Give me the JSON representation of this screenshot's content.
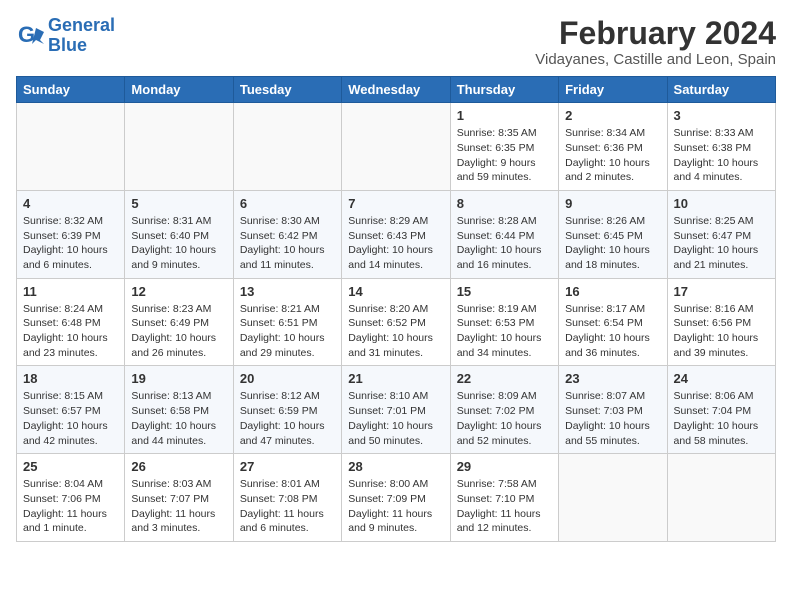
{
  "logo": {
    "text_general": "General",
    "text_blue": "Blue"
  },
  "title": "February 2024",
  "subtitle": "Vidayanes, Castille and Leon, Spain",
  "weekdays": [
    "Sunday",
    "Monday",
    "Tuesday",
    "Wednesday",
    "Thursday",
    "Friday",
    "Saturday"
  ],
  "weeks": [
    [
      {
        "day": "",
        "info": ""
      },
      {
        "day": "",
        "info": ""
      },
      {
        "day": "",
        "info": ""
      },
      {
        "day": "",
        "info": ""
      },
      {
        "day": "1",
        "info": "Sunrise: 8:35 AM\nSunset: 6:35 PM\nDaylight: 9 hours\nand 59 minutes."
      },
      {
        "day": "2",
        "info": "Sunrise: 8:34 AM\nSunset: 6:36 PM\nDaylight: 10 hours\nand 2 minutes."
      },
      {
        "day": "3",
        "info": "Sunrise: 8:33 AM\nSunset: 6:38 PM\nDaylight: 10 hours\nand 4 minutes."
      }
    ],
    [
      {
        "day": "4",
        "info": "Sunrise: 8:32 AM\nSunset: 6:39 PM\nDaylight: 10 hours\nand 6 minutes."
      },
      {
        "day": "5",
        "info": "Sunrise: 8:31 AM\nSunset: 6:40 PM\nDaylight: 10 hours\nand 9 minutes."
      },
      {
        "day": "6",
        "info": "Sunrise: 8:30 AM\nSunset: 6:42 PM\nDaylight: 10 hours\nand 11 minutes."
      },
      {
        "day": "7",
        "info": "Sunrise: 8:29 AM\nSunset: 6:43 PM\nDaylight: 10 hours\nand 14 minutes."
      },
      {
        "day": "8",
        "info": "Sunrise: 8:28 AM\nSunset: 6:44 PM\nDaylight: 10 hours\nand 16 minutes."
      },
      {
        "day": "9",
        "info": "Sunrise: 8:26 AM\nSunset: 6:45 PM\nDaylight: 10 hours\nand 18 minutes."
      },
      {
        "day": "10",
        "info": "Sunrise: 8:25 AM\nSunset: 6:47 PM\nDaylight: 10 hours\nand 21 minutes."
      }
    ],
    [
      {
        "day": "11",
        "info": "Sunrise: 8:24 AM\nSunset: 6:48 PM\nDaylight: 10 hours\nand 23 minutes."
      },
      {
        "day": "12",
        "info": "Sunrise: 8:23 AM\nSunset: 6:49 PM\nDaylight: 10 hours\nand 26 minutes."
      },
      {
        "day": "13",
        "info": "Sunrise: 8:21 AM\nSunset: 6:51 PM\nDaylight: 10 hours\nand 29 minutes."
      },
      {
        "day": "14",
        "info": "Sunrise: 8:20 AM\nSunset: 6:52 PM\nDaylight: 10 hours\nand 31 minutes."
      },
      {
        "day": "15",
        "info": "Sunrise: 8:19 AM\nSunset: 6:53 PM\nDaylight: 10 hours\nand 34 minutes."
      },
      {
        "day": "16",
        "info": "Sunrise: 8:17 AM\nSunset: 6:54 PM\nDaylight: 10 hours\nand 36 minutes."
      },
      {
        "day": "17",
        "info": "Sunrise: 8:16 AM\nSunset: 6:56 PM\nDaylight: 10 hours\nand 39 minutes."
      }
    ],
    [
      {
        "day": "18",
        "info": "Sunrise: 8:15 AM\nSunset: 6:57 PM\nDaylight: 10 hours\nand 42 minutes."
      },
      {
        "day": "19",
        "info": "Sunrise: 8:13 AM\nSunset: 6:58 PM\nDaylight: 10 hours\nand 44 minutes."
      },
      {
        "day": "20",
        "info": "Sunrise: 8:12 AM\nSunset: 6:59 PM\nDaylight: 10 hours\nand 47 minutes."
      },
      {
        "day": "21",
        "info": "Sunrise: 8:10 AM\nSunset: 7:01 PM\nDaylight: 10 hours\nand 50 minutes."
      },
      {
        "day": "22",
        "info": "Sunrise: 8:09 AM\nSunset: 7:02 PM\nDaylight: 10 hours\nand 52 minutes."
      },
      {
        "day": "23",
        "info": "Sunrise: 8:07 AM\nSunset: 7:03 PM\nDaylight: 10 hours\nand 55 minutes."
      },
      {
        "day": "24",
        "info": "Sunrise: 8:06 AM\nSunset: 7:04 PM\nDaylight: 10 hours\nand 58 minutes."
      }
    ],
    [
      {
        "day": "25",
        "info": "Sunrise: 8:04 AM\nSunset: 7:06 PM\nDaylight: 11 hours\nand 1 minute."
      },
      {
        "day": "26",
        "info": "Sunrise: 8:03 AM\nSunset: 7:07 PM\nDaylight: 11 hours\nand 3 minutes."
      },
      {
        "day": "27",
        "info": "Sunrise: 8:01 AM\nSunset: 7:08 PM\nDaylight: 11 hours\nand 6 minutes."
      },
      {
        "day": "28",
        "info": "Sunrise: 8:00 AM\nSunset: 7:09 PM\nDaylight: 11 hours\nand 9 minutes."
      },
      {
        "day": "29",
        "info": "Sunrise: 7:58 AM\nSunset: 7:10 PM\nDaylight: 11 hours\nand 12 minutes."
      },
      {
        "day": "",
        "info": ""
      },
      {
        "day": "",
        "info": ""
      }
    ]
  ]
}
